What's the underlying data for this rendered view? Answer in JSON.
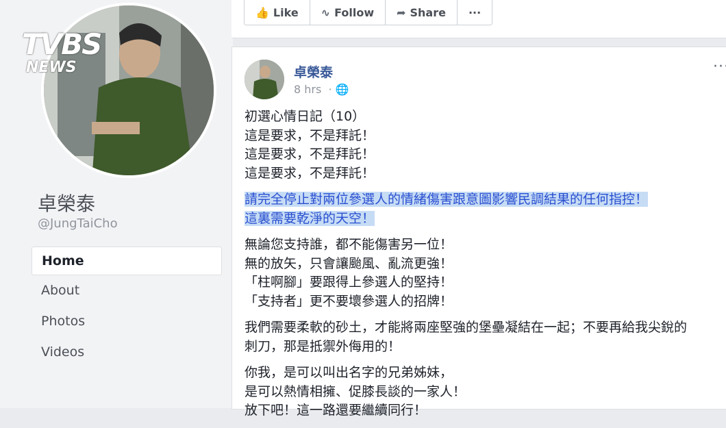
{
  "profile": {
    "name": "卓榮泰",
    "handle": "@JungTaiCho",
    "logo_text": "TVBS",
    "logo_sub": "NEWS"
  },
  "nav": [
    {
      "label": "Home",
      "active": true
    },
    {
      "label": "About",
      "active": false
    },
    {
      "label": "Photos",
      "active": false
    },
    {
      "label": "Videos",
      "active": false
    }
  ],
  "actions": {
    "like": "Like",
    "follow": "Follow",
    "share": "Share",
    "more": "···"
  },
  "post": {
    "author": "卓榮泰",
    "time": "8 hrs",
    "privacy_icon": "globe-icon",
    "more": "···",
    "para1": [
      "初選心情日記（10）",
      "這是要求，不是拜託！",
      "這是要求，不是拜託！",
      "這是要求，不是拜託！"
    ],
    "highlight": [
      "請完全停止對兩位參選人的情緒傷害跟意圖影響民調結果的任何指控！",
      "這裏需要乾淨的天空！"
    ],
    "para2": [
      "無論您支持誰，都不能傷害另一位！",
      "無的放矢，只會讓颱風、亂流更強！",
      "「柱啊腳」要跟得上參選人的堅持！",
      "「支持者」更不要壞參選人的招牌！"
    ],
    "para3": [
      "我們需要柔軟的砂土，才能將兩座堅強的堡壘凝結在一起；不要再給我尖銳的",
      "刺刀，那是抵禦外侮用的！"
    ],
    "para4": [
      "你我，是可以叫出名字的兄弟姊妹，",
      "是可以熱情相擁、促膝長談的一家人！",
      "放下吧！這一路還要繼續同行！"
    ]
  },
  "colors": {
    "link": "#385898",
    "highlight_bg": "#c6dcf5",
    "highlight_text": "#2a4fd1"
  }
}
